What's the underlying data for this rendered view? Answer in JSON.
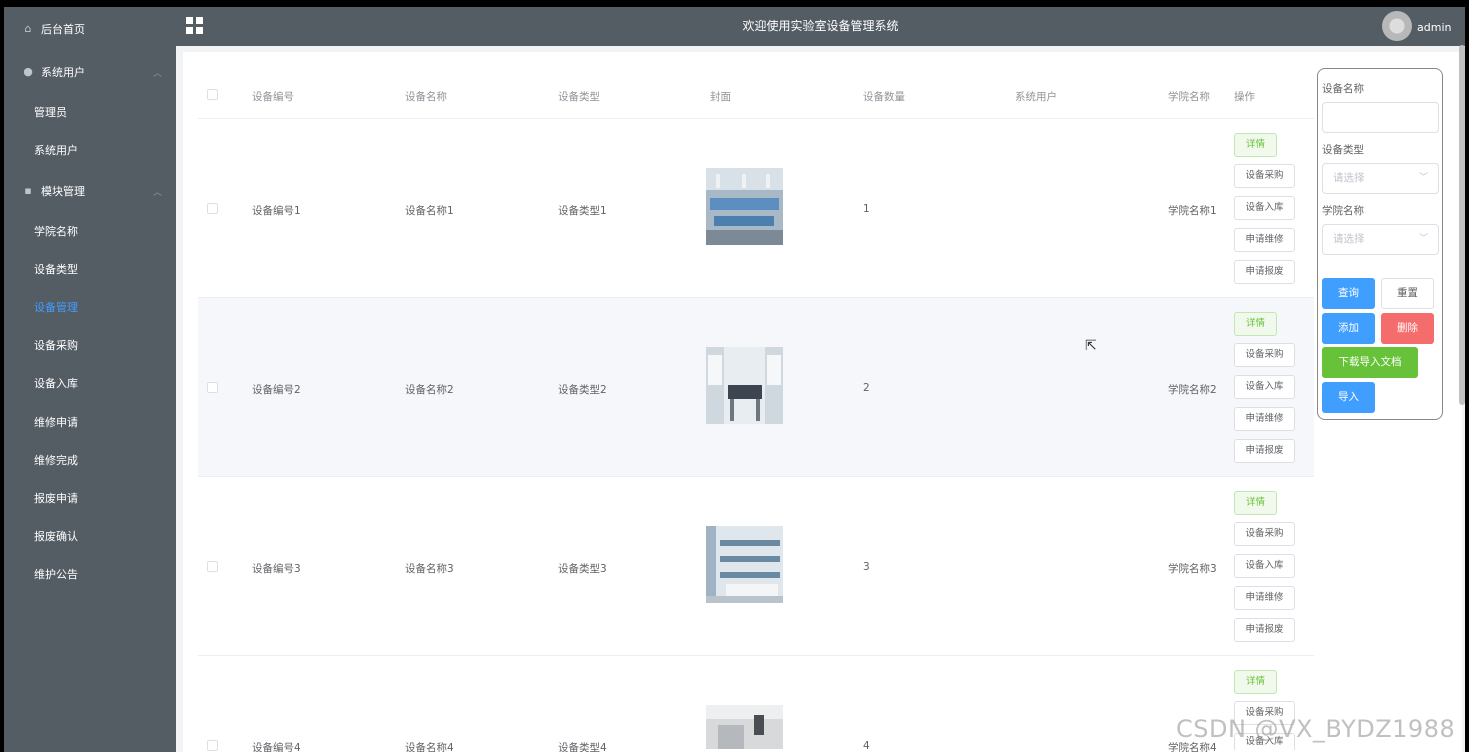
{
  "header": {
    "title": "欢迎使用实验室设备管理系统",
    "username": "admin"
  },
  "sidebar": {
    "home": "后台首页",
    "group_users": "系统用户",
    "users_items": [
      "管理员",
      "系统用户"
    ],
    "group_modules": "模块管理",
    "module_items": [
      "学院名称",
      "设备类型",
      "设备管理",
      "设备采购",
      "设备入库",
      "维修申请",
      "维修完成",
      "报废申请",
      "报废确认",
      "维护公告"
    ],
    "active_item": "设备管理"
  },
  "table": {
    "columns": [
      "设备编号",
      "设备名称",
      "设备类型",
      "封面",
      "设备数量",
      "系统用户",
      "学院名称",
      "操作"
    ],
    "rows": [
      {
        "code": "设备编号1",
        "name": "设备名称1",
        "type": "设备类型1",
        "qty": "1",
        "user": "",
        "college": "学院名称1"
      },
      {
        "code": "设备编号2",
        "name": "设备名称2",
        "type": "设备类型2",
        "qty": "2",
        "user": "",
        "college": "学院名称2"
      },
      {
        "code": "设备编号3",
        "name": "设备名称3",
        "type": "设备类型3",
        "qty": "3",
        "user": "",
        "college": "学院名称3"
      },
      {
        "code": "设备编号4",
        "name": "设备名称4",
        "type": "设备类型4",
        "qty": "4",
        "user": "",
        "college": "学院名称4"
      }
    ],
    "actions": [
      "详情",
      "设备采购",
      "设备入库",
      "申请维修",
      "申请报废"
    ]
  },
  "search": {
    "name_label": "设备名称",
    "type_label": "设备类型",
    "type_placeholder": "请选择",
    "college_label": "学院名称",
    "college_placeholder": "请选择",
    "query": "查询",
    "reset": "重置",
    "add": "添加",
    "delete": "删除",
    "download": "下载导入文档",
    "import": "导入"
  },
  "watermark": "CSDN @VX_BYDZ1988",
  "colors": {
    "sidebar": "#545c64",
    "active": "#409eff",
    "primary": "#409eff",
    "danger": "#f56c6c",
    "success": "#67c23a"
  }
}
